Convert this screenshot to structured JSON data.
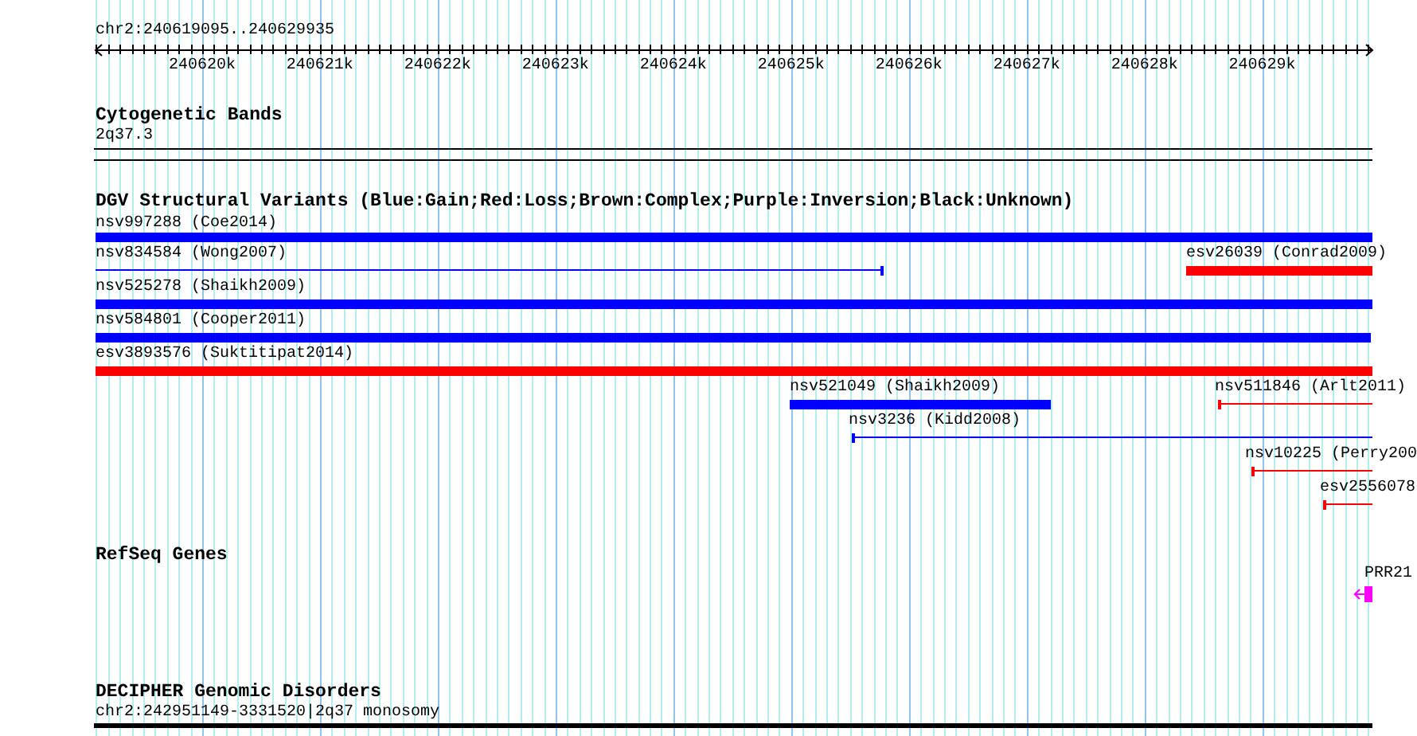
{
  "ruler": {
    "range": "chr2:240619095..240629935",
    "ticks": [
      "240620k",
      "240621k",
      "240622k",
      "240623k",
      "240624k",
      "240625k",
      "240626k",
      "240627k",
      "240628k",
      "240629k"
    ]
  },
  "tracks": [
    {
      "title": "Cytogenetic Bands",
      "kind": "bands",
      "items": [
        {
          "label": "2q37.3"
        }
      ]
    },
    {
      "title": "DGV Structural Variants (Blue:Gain;Red:Loss;Brown:Complex;Purple:Inversion;Black:Unknown)",
      "kind": "variants",
      "items": [
        {
          "label": "nsv997288 (Coe2014)",
          "color": "#0000ff",
          "kind": "thick"
        },
        {
          "label": "nsv834584 (Wong2007)",
          "color": "#0000ff",
          "kind": "thin"
        },
        {
          "label": "esv26039 (Conrad2009)",
          "color": "#ff0000",
          "kind": "thick"
        },
        {
          "label": "nsv525278 (Shaikh2009)",
          "color": "#0000ff",
          "kind": "thick"
        },
        {
          "label": "nsv584801 (Cooper2011)",
          "color": "#0000ff",
          "kind": "thick"
        },
        {
          "label": "esv3893576 (Suktitipat2014)",
          "color": "#ff0000",
          "kind": "thick"
        },
        {
          "label": "nsv521049 (Shaikh2009)",
          "color": "#0000ff",
          "kind": "thick"
        },
        {
          "label": "nsv511846 (Arlt2011)",
          "color": "#ff0000",
          "kind": "thin"
        },
        {
          "label": "nsv3236 (Kidd2008)",
          "color": "#0000ff",
          "kind": "thin"
        },
        {
          "label": "nsv10225 (Perry200",
          "color": "#ff0000",
          "kind": "thin"
        },
        {
          "label": "esv2556078",
          "color": "#ff0000",
          "kind": "thin"
        }
      ]
    },
    {
      "title": "RefSeq Genes",
      "kind": "genes",
      "items": [
        {
          "label": "PRR21",
          "color": "#ff00ff"
        }
      ]
    },
    {
      "title": "DECIPHER Genomic Disorders",
      "kind": "disorders",
      "items": [
        {
          "label": "chr2:242951149-3331520|2q37 monosomy"
        }
      ]
    }
  ]
}
